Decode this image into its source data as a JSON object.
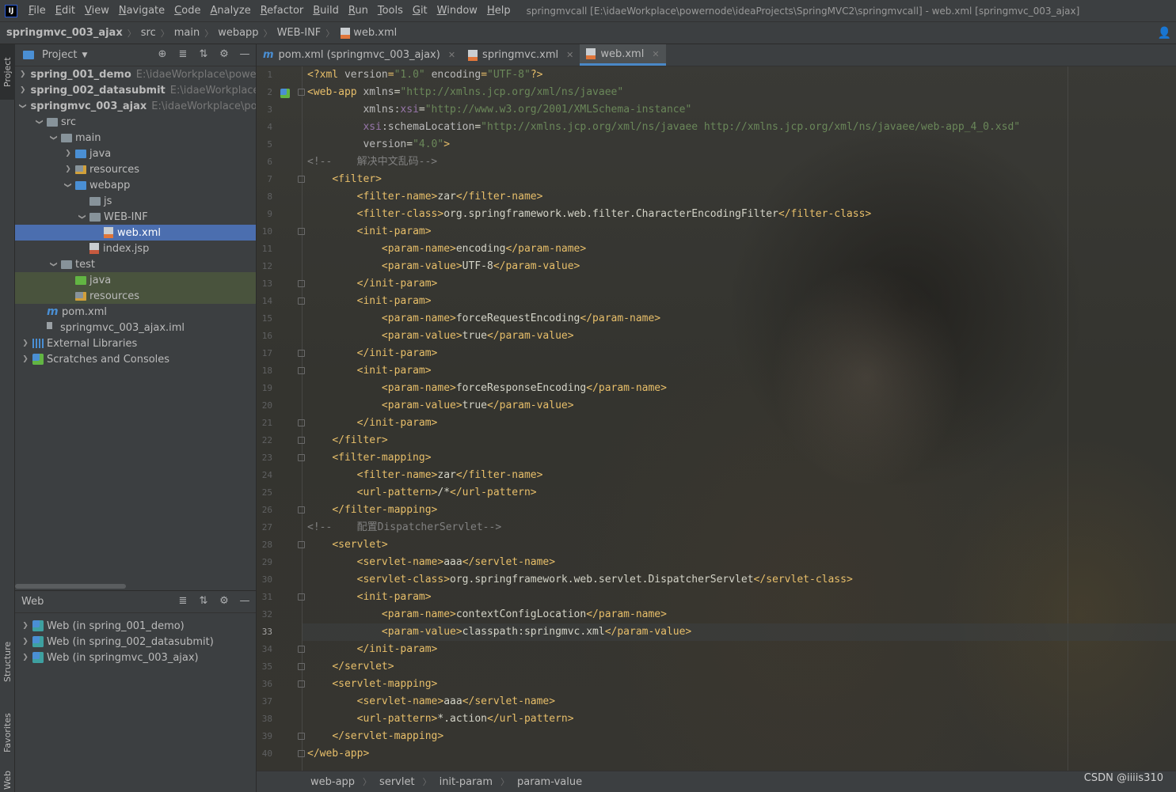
{
  "menubar": {
    "logo": "IJ",
    "items": [
      "File",
      "Edit",
      "View",
      "Navigate",
      "Code",
      "Analyze",
      "Refactor",
      "Build",
      "Run",
      "Tools",
      "Git",
      "Window",
      "Help"
    ],
    "window_title": "springmvcall [E:\\idaeWorkplace\\powernode\\ideaProjects\\SpringMVC2\\springmvcall] - web.xml [springmvc_003_ajax]"
  },
  "navbar": {
    "crumbs": [
      "springmvc_003_ajax",
      "src",
      "main",
      "webapp",
      "WEB-INF",
      "web.xml"
    ]
  },
  "left_strip": {
    "tabs": [
      "Project",
      "Structure",
      "Favorites",
      "Web"
    ]
  },
  "project_panel": {
    "title": "Project",
    "tree": [
      {
        "label": "spring_001_demo",
        "hint": "E:\\idaeWorkplace\\powern",
        "depth": 0,
        "chevron": ">",
        "icon": "module",
        "bold": true
      },
      {
        "label": "spring_002_datasubmit",
        "hint": "E:\\idaeWorkplace\\p",
        "depth": 0,
        "chevron": ">",
        "icon": "module",
        "bold": true
      },
      {
        "label": "springmvc_003_ajax",
        "hint": "E:\\idaeWorkplace\\pow",
        "depth": 0,
        "chevron": "v",
        "icon": "module",
        "bold": true
      },
      {
        "label": "src",
        "depth": 1,
        "chevron": "v",
        "icon": "folder"
      },
      {
        "label": "main",
        "depth": 2,
        "chevron": "v",
        "icon": "folder"
      },
      {
        "label": "java",
        "depth": 3,
        "chevron": ">",
        "icon": "folder-blue"
      },
      {
        "label": "resources",
        "depth": 3,
        "chevron": ">",
        "icon": "folder-res"
      },
      {
        "label": "webapp",
        "depth": 3,
        "chevron": "v",
        "icon": "folder-web"
      },
      {
        "label": "js",
        "depth": 4,
        "chevron": "",
        "icon": "folder"
      },
      {
        "label": "WEB-INF",
        "depth": 4,
        "chevron": "v",
        "icon": "folder"
      },
      {
        "label": "web.xml",
        "depth": 5,
        "chevron": "",
        "icon": "xml",
        "selected": true
      },
      {
        "label": "index.jsp",
        "depth": 4,
        "chevron": "",
        "icon": "jsp"
      },
      {
        "label": "test",
        "depth": 2,
        "chevron": "v",
        "icon": "folder"
      },
      {
        "label": "java",
        "depth": 3,
        "chevron": "",
        "icon": "folder-green",
        "test": true
      },
      {
        "label": "resources",
        "depth": 3,
        "chevron": "",
        "icon": "folder-res",
        "test": true
      },
      {
        "label": "pom.xml",
        "depth": 1,
        "chevron": "",
        "icon": "maven"
      },
      {
        "label": "springmvc_003_ajax.iml",
        "depth": 1,
        "chevron": "",
        "icon": "iml"
      },
      {
        "label": "External Libraries",
        "depth": 0,
        "chevron": ">",
        "icon": "lib"
      },
      {
        "label": "Scratches and Consoles",
        "depth": 0,
        "chevron": ">",
        "icon": "scratch"
      }
    ]
  },
  "web_panel": {
    "title": "Web",
    "items": [
      "Web (in spring_001_demo)",
      "Web (in spring_002_datasubmit)",
      "Web (in springmvc_003_ajax)"
    ]
  },
  "editor": {
    "tabs": [
      {
        "label": "pom.xml (springmvc_003_ajax)",
        "icon": "maven",
        "active": false
      },
      {
        "label": "springmvc.xml",
        "icon": "xml",
        "active": false
      },
      {
        "label": "web.xml",
        "icon": "xml",
        "active": true
      }
    ],
    "current_line": 33,
    "lines": [
      [
        [
          "pi",
          "<?xml "
        ],
        [
          "attr",
          "version"
        ],
        [
          "pi",
          "="
        ],
        [
          "str",
          "\"1.0\""
        ],
        [
          "pi",
          " "
        ],
        [
          "attr",
          "encoding"
        ],
        [
          "pi",
          "="
        ],
        [
          "str",
          "\"UTF-8\""
        ],
        [
          "pi",
          "?>"
        ]
      ],
      [
        [
          "tag",
          "<web-app "
        ],
        [
          "attr",
          "xmlns"
        ],
        [
          "txt",
          "="
        ],
        [
          "str",
          "\"http://xmlns.jcp.org/xml/ns/javaee\""
        ]
      ],
      [
        [
          "txt",
          "         "
        ],
        [
          "attr",
          "xmlns:"
        ],
        [
          "ns",
          "xsi"
        ],
        [
          "txt",
          "="
        ],
        [
          "str",
          "\"http://www.w3.org/2001/XMLSchema-instance\""
        ]
      ],
      [
        [
          "txt",
          "         "
        ],
        [
          "ns",
          "xsi"
        ],
        [
          "attr",
          ":schemaLocation"
        ],
        [
          "txt",
          "="
        ],
        [
          "str",
          "\"http://xmlns.jcp.org/xml/ns/javaee http://xmlns.jcp.org/xml/ns/javaee/web-app_4_0.xsd\""
        ]
      ],
      [
        [
          "txt",
          "         "
        ],
        [
          "attr",
          "version"
        ],
        [
          "txt",
          "="
        ],
        [
          "str",
          "\"4.0\""
        ],
        [
          "tag",
          ">"
        ]
      ],
      [
        [
          "com",
          "<!--    解决中文乱码-->"
        ]
      ],
      [
        [
          "txt",
          "    "
        ],
        [
          "tag",
          "<filter>"
        ]
      ],
      [
        [
          "txt",
          "        "
        ],
        [
          "tag",
          "<filter-name>"
        ],
        [
          "txt",
          "zar"
        ],
        [
          "tag",
          "</filter-name>"
        ]
      ],
      [
        [
          "txt",
          "        "
        ],
        [
          "tag",
          "<filter-class>"
        ],
        [
          "txt",
          "org.springframework.web.filter.CharacterEncodingFilter"
        ],
        [
          "tag",
          "</filter-class>"
        ]
      ],
      [
        [
          "txt",
          "        "
        ],
        [
          "tag",
          "<init-param>"
        ]
      ],
      [
        [
          "txt",
          "            "
        ],
        [
          "tag",
          "<param-name>"
        ],
        [
          "txt",
          "encoding"
        ],
        [
          "tag",
          "</param-name>"
        ]
      ],
      [
        [
          "txt",
          "            "
        ],
        [
          "tag",
          "<param-value>"
        ],
        [
          "txt",
          "UTF-8"
        ],
        [
          "tag",
          "</param-value>"
        ]
      ],
      [
        [
          "txt",
          "        "
        ],
        [
          "tag",
          "</init-param>"
        ]
      ],
      [
        [
          "txt",
          "        "
        ],
        [
          "tag",
          "<init-param>"
        ]
      ],
      [
        [
          "txt",
          "            "
        ],
        [
          "tag",
          "<param-name>"
        ],
        [
          "txt",
          "forceRequestEncoding"
        ],
        [
          "tag",
          "</param-name>"
        ]
      ],
      [
        [
          "txt",
          "            "
        ],
        [
          "tag",
          "<param-value>"
        ],
        [
          "txt",
          "true"
        ],
        [
          "tag",
          "</param-value>"
        ]
      ],
      [
        [
          "txt",
          "        "
        ],
        [
          "tag",
          "</init-param>"
        ]
      ],
      [
        [
          "txt",
          "        "
        ],
        [
          "tag",
          "<init-param>"
        ]
      ],
      [
        [
          "txt",
          "            "
        ],
        [
          "tag",
          "<param-name>"
        ],
        [
          "txt",
          "forceResponseEncoding"
        ],
        [
          "tag",
          "</param-name>"
        ]
      ],
      [
        [
          "txt",
          "            "
        ],
        [
          "tag",
          "<param-value>"
        ],
        [
          "txt",
          "true"
        ],
        [
          "tag",
          "</param-value>"
        ]
      ],
      [
        [
          "txt",
          "        "
        ],
        [
          "tag",
          "</init-param>"
        ]
      ],
      [
        [
          "txt",
          "    "
        ],
        [
          "tag",
          "</filter>"
        ]
      ],
      [
        [
          "txt",
          "    "
        ],
        [
          "tag",
          "<filter-mapping>"
        ]
      ],
      [
        [
          "txt",
          "        "
        ],
        [
          "tag",
          "<filter-name>"
        ],
        [
          "txt",
          "zar"
        ],
        [
          "tag",
          "</filter-name>"
        ]
      ],
      [
        [
          "txt",
          "        "
        ],
        [
          "tag",
          "<url-pattern>"
        ],
        [
          "txt",
          "/*"
        ],
        [
          "tag",
          "</url-pattern>"
        ]
      ],
      [
        [
          "txt",
          "    "
        ],
        [
          "tag",
          "</filter-mapping>"
        ]
      ],
      [
        [
          "com",
          "<!--    配置DispatcherServlet-->"
        ]
      ],
      [
        [
          "txt",
          "    "
        ],
        [
          "tag",
          "<servlet>"
        ]
      ],
      [
        [
          "txt",
          "        "
        ],
        [
          "tag",
          "<servlet-name>"
        ],
        [
          "txt",
          "aaa"
        ],
        [
          "tag",
          "</servlet-name>"
        ]
      ],
      [
        [
          "txt",
          "        "
        ],
        [
          "tag",
          "<servlet-class>"
        ],
        [
          "txt",
          "org.springframework.web.servlet.DispatcherServlet"
        ],
        [
          "tag",
          "</servlet-class>"
        ]
      ],
      [
        [
          "txt",
          "        "
        ],
        [
          "tag",
          "<init-param>"
        ]
      ],
      [
        [
          "txt",
          "            "
        ],
        [
          "tag",
          "<param-name>"
        ],
        [
          "txt",
          "contextConfigLocation"
        ],
        [
          "tag",
          "</param-name>"
        ]
      ],
      [
        [
          "txt",
          "            "
        ],
        [
          "tag",
          "<param-value>"
        ],
        [
          "txt",
          "classpath:springmvc.xml"
        ],
        [
          "tag",
          "</param-value>"
        ]
      ],
      [
        [
          "txt",
          "        "
        ],
        [
          "tag",
          "</init-param>"
        ]
      ],
      [
        [
          "txt",
          "    "
        ],
        [
          "tag",
          "</servlet>"
        ]
      ],
      [
        [
          "txt",
          "    "
        ],
        [
          "tag",
          "<servlet-mapping>"
        ]
      ],
      [
        [
          "txt",
          "        "
        ],
        [
          "tag",
          "<servlet-name>"
        ],
        [
          "txt",
          "aaa"
        ],
        [
          "tag",
          "</servlet-name>"
        ]
      ],
      [
        [
          "txt",
          "        "
        ],
        [
          "tag",
          "<url-pattern>"
        ],
        [
          "txt",
          "*.action"
        ],
        [
          "tag",
          "</url-pattern>"
        ]
      ],
      [
        [
          "txt",
          "    "
        ],
        [
          "tag",
          "</servlet-mapping>"
        ]
      ],
      [
        [
          "tag",
          "</web-app>"
        ]
      ]
    ],
    "fold_lines": [
      2,
      7,
      10,
      13,
      14,
      17,
      18,
      21,
      22,
      23,
      26,
      28,
      31,
      34,
      35,
      36,
      39,
      40
    ],
    "breadcrumbs": [
      "web-app",
      "servlet",
      "init-param",
      "param-value"
    ]
  },
  "watermark": "CSDN @iiiis310"
}
